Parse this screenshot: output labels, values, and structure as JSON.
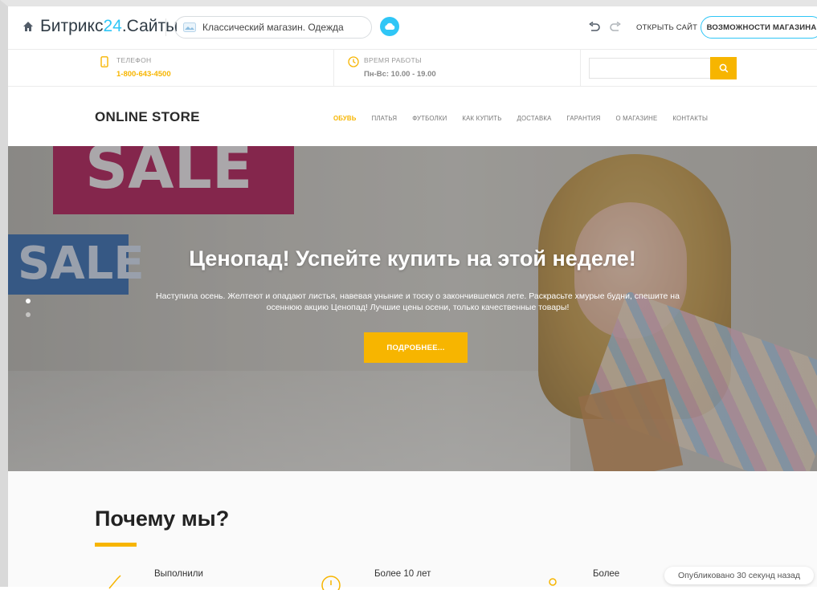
{
  "toolbar": {
    "brand_prefix": "Битрикс",
    "brand_num": "24",
    "brand_suffix": ".Сайты",
    "site_name": "Классический магазин. Одежда",
    "open_site": "ОТКРЫТЬ САЙТ",
    "features": "ВОЗМОЖНОСТИ МАГАЗИНА",
    "accent_color": "#2fc6f6"
  },
  "contacts": {
    "phone_label": "ТЕЛЕФОН",
    "phone_value": "1-800-643-4500",
    "hours_label": "ВРЕМЯ РАБОТЫ",
    "hours_value": "Пн-Вс: 10.00 - 19.00",
    "search_placeholder": "",
    "accent_color": "#f7b500"
  },
  "header": {
    "logo": "ONLINE STORE",
    "nav": [
      {
        "label": "ОБУВЬ",
        "active": true
      },
      {
        "label": "ПЛАТЬЯ"
      },
      {
        "label": "ФУТБОЛКИ"
      },
      {
        "label": "КАК КУПИТЬ"
      },
      {
        "label": "ДОСТАВКА"
      },
      {
        "label": "ГАРАНТИЯ"
      },
      {
        "label": "О МАГАЗИНЕ"
      },
      {
        "label": "КОНТАКТЫ"
      }
    ]
  },
  "hero": {
    "sale_sign_1": "SALE",
    "sale_sign_2": "SALE",
    "title": "Ценопад! Успейте купить на этой неделе!",
    "text_line1": "Наступила осень. Желтеют и опадают листья, навевая уныние и тоску о закончившемся лете. Раскрасьте хмурые будни, спешите на",
    "text_line2": "осеннюю акцию Ценопад! Лучшие цены осени, только качественные товары!",
    "button": "ПОДРОБНЕЕ...",
    "slide_count": 2,
    "active_slide": 1
  },
  "why": {
    "title": "Почему мы?",
    "features": [
      {
        "icon": "rocket-icon",
        "text": "Выполнили"
      },
      {
        "icon": "clock-icon",
        "text": "Более 10 лет"
      },
      {
        "icon": "location-pin-icon",
        "text": "Более"
      }
    ]
  },
  "toast": {
    "text": "Опубликовано 30 секунд назад"
  }
}
